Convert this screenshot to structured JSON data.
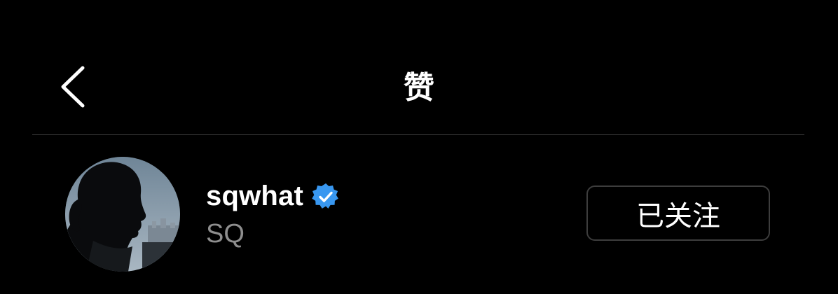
{
  "header": {
    "title": "赞",
    "back_icon": "chevron-left-icon"
  },
  "likes": [
    {
      "username": "sqwhat",
      "verified": true,
      "verified_icon": "verified-badge-icon",
      "full_name": "SQ",
      "follow_label": "已关注"
    }
  ],
  "colors": {
    "background": "#000000",
    "text_primary": "#ffffff",
    "text_secondary": "#8e8e8e",
    "verified": "#3897f0",
    "divider": "#3a3a3a",
    "button_border": "#3d3d3d"
  }
}
